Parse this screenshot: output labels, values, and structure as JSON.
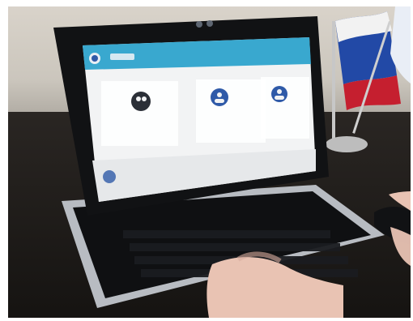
{
  "screen": {
    "header_title_line1": "",
    "header_title_line2": "",
    "tile_left_label": "",
    "tile_mid_label": "",
    "tile_right_label": "",
    "footer_line1": "",
    "footer_line2": ""
  },
  "colors": {
    "screen_header": "#39a8cf",
    "screen_body": "#f2f3f4",
    "tile_icon_dark": "#2b2f37",
    "tile_icon_blue": "#2f5aa8",
    "flag_red": "#c51f2f",
    "flag_blue": "#2249a6",
    "flag_white": "#f2f2f2",
    "laptop_frame": "#111214",
    "keyboard": "#0f1012",
    "skin": "#e9c3b3"
  }
}
